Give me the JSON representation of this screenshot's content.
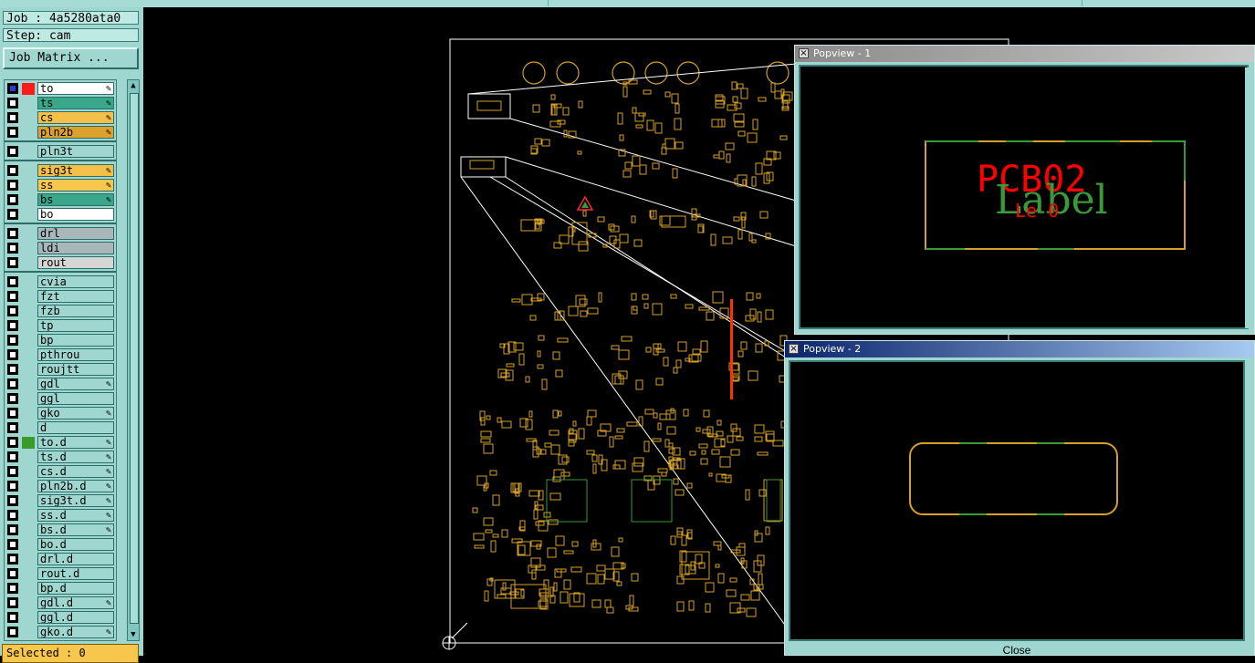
{
  "job": {
    "label": "Job : 4a5280ata0"
  },
  "step": {
    "label": "Step: cam"
  },
  "job_matrix": {
    "label": "Job Matrix ..."
  },
  "layers": [
    {
      "name": "to",
      "color": "#ffffff",
      "pen": true
    },
    {
      "name": "ts",
      "color": "#3aa78a",
      "pen": true
    },
    {
      "name": "cs",
      "color": "#f5c04a",
      "pen": true
    },
    {
      "name": "pln2b",
      "color": "#dca12a",
      "pen": true
    },
    {
      "name": "pln3t",
      "color": "#9fd6cf",
      "pen": false
    },
    {
      "name": "sig3t",
      "color": "#f5c04a",
      "pen": true
    },
    {
      "name": "ss",
      "color": "#f7c64d",
      "pen": true
    },
    {
      "name": "bs",
      "color": "#3aa78a",
      "pen": true
    },
    {
      "name": "bo",
      "color": "#ffffff",
      "pen": false
    },
    {
      "name": "drl",
      "color": "#a9b7bd",
      "pen": false
    },
    {
      "name": "ldi",
      "color": "#a9b7bd",
      "pen": false
    },
    {
      "name": "rout",
      "color": "#d6d6d6",
      "pen": false
    },
    {
      "name": "cvia",
      "color": "#9fd6cf",
      "pen": false
    },
    {
      "name": "fzt",
      "color": "#9fd6cf",
      "pen": false
    },
    {
      "name": "fzb",
      "color": "#9fd6cf",
      "pen": false
    },
    {
      "name": "tp",
      "color": "#9fd6cf",
      "pen": false
    },
    {
      "name": "bp",
      "color": "#9fd6cf",
      "pen": false
    },
    {
      "name": "pthrou",
      "color": "#9fd6cf",
      "pen": false
    },
    {
      "name": "roujtt",
      "color": "#9fd6cf",
      "pen": false
    },
    {
      "name": "gdl",
      "color": "#9fd6cf",
      "pen": true
    },
    {
      "name": "ggl",
      "color": "#9fd6cf",
      "pen": false
    },
    {
      "name": "gko",
      "color": "#9fd6cf",
      "pen": true
    },
    {
      "name": "d",
      "color": "#9fd6cf",
      "pen": false
    },
    {
      "name": "to.d",
      "color": "#9fd6cf",
      "pen": true
    },
    {
      "name": "ts.d",
      "color": "#9fd6cf",
      "pen": true
    },
    {
      "name": "cs.d",
      "color": "#9fd6cf",
      "pen": true
    },
    {
      "name": "pln2b.d",
      "color": "#9fd6cf",
      "pen": true
    },
    {
      "name": "sig3t.d",
      "color": "#9fd6cf",
      "pen": true
    },
    {
      "name": "ss.d",
      "color": "#9fd6cf",
      "pen": true
    },
    {
      "name": "bs.d",
      "color": "#9fd6cf",
      "pen": true
    },
    {
      "name": "bo.d",
      "color": "#9fd6cf",
      "pen": false
    },
    {
      "name": "drl.d",
      "color": "#9fd6cf",
      "pen": false
    },
    {
      "name": "rout.d",
      "color": "#9fd6cf",
      "pen": false
    },
    {
      "name": "bp.d",
      "color": "#9fd6cf",
      "pen": false
    },
    {
      "name": "gdl.d",
      "color": "#9fd6cf",
      "pen": true
    },
    {
      "name": "ggl.d",
      "color": "#9fd6cf",
      "pen": false
    },
    {
      "name": "gko.d",
      "color": "#9fd6cf",
      "pen": true
    }
  ],
  "status": {
    "selected": "Selected : 0"
  },
  "popview1": {
    "title": "Popview - 1",
    "pcb_text": "PCB02",
    "label_text": "Label",
    "small_text": "Le 0"
  },
  "popview2": {
    "title": "Popview - 2",
    "close_label": "Close"
  },
  "colors": {
    "board_outline": "#ffffff",
    "component": "#d4a02a",
    "green": "#3a9a3a",
    "red": "#ff0000"
  }
}
